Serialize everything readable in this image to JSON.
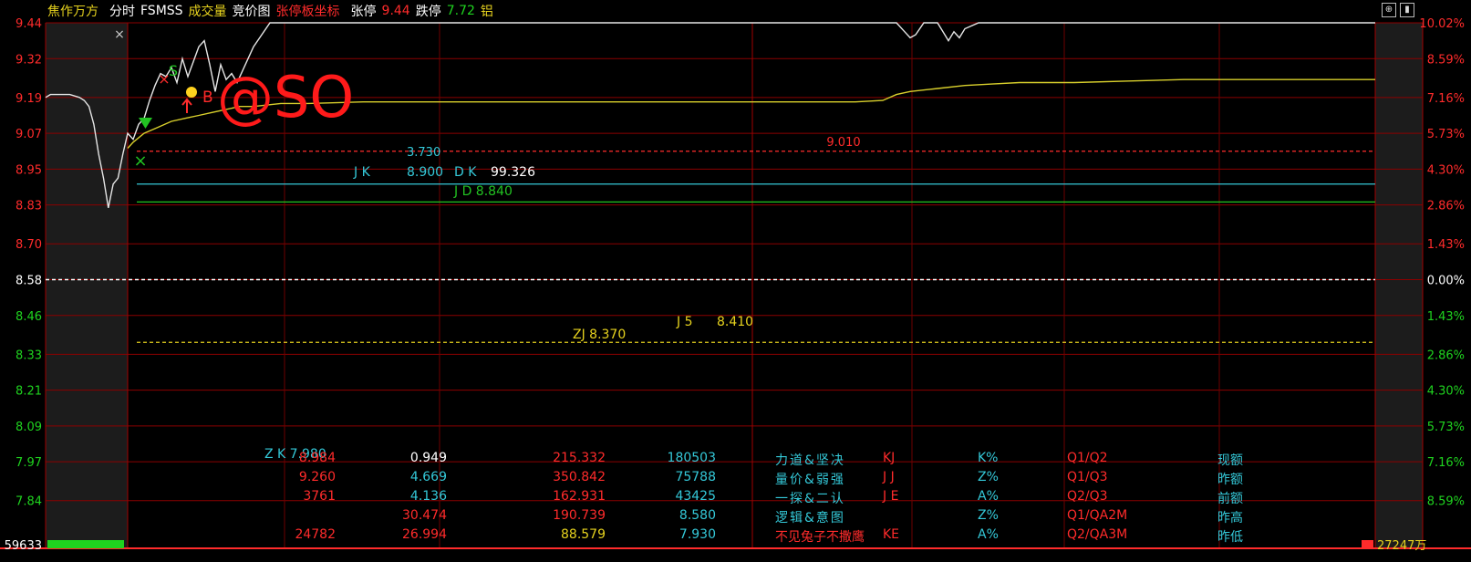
{
  "header": {
    "stock_name": "焦作万方",
    "tab_fenshi": "分时",
    "tab_fsmss": "FSMSS",
    "tab_volume": "成交量",
    "tab_auction": "竞价图",
    "tab_limit_coord": "张停板坐标",
    "limit_up_label": "张停",
    "limit_up_value": "9.44",
    "limit_down_label": "跌停",
    "limit_down_value": "7.72",
    "sector": "铝",
    "close_mark": "×"
  },
  "colors": {
    "price_up": "#ff2b2b",
    "price_down": "#1fd31f",
    "price_line": "#e6e6e6",
    "avg_line": "#d8cf2c",
    "grid": "#8b0000",
    "cyan": "#34c8d8",
    "yellow": "#e6d21e",
    "green": "#22c322"
  },
  "chart_data": {
    "type": "line",
    "title": "",
    "xlabel": "",
    "ylabel": "",
    "prev_close": 8.58,
    "ylim": [
      7.72,
      9.44
    ],
    "y_ticks": [
      "9.44",
      "9.32",
      "9.19",
      "9.07",
      "8.95",
      "8.83",
      "8.70",
      "8.58",
      "8.46",
      "8.33",
      "8.21",
      "8.09",
      "7.97",
      "7.84"
    ],
    "pct_ticks": [
      "10.02%",
      "8.59%",
      "7.16%",
      "5.73%",
      "4.30%",
      "2.86%",
      "1.43%",
      "0.00%",
      "1.43%",
      "2.86%",
      "4.30%",
      "5.73%",
      "7.16%",
      "8.59%"
    ],
    "volume_label": "59633",
    "volume_right_label": "27247万",
    "series": [
      {
        "key": "price",
        "t": [
          0,
          2,
          6,
          10,
          14,
          16,
          18,
          20,
          22,
          24,
          26,
          28,
          30,
          32,
          34,
          36,
          38,
          40,
          42,
          44,
          46,
          48,
          50,
          52,
          54,
          56,
          58,
          60,
          62,
          64,
          66,
          68,
          70,
          72,
          74,
          76,
          78,
          80,
          83,
          86,
          90,
          95,
          100,
          110,
          130,
          200,
          300,
          315,
          318,
          320,
          322,
          325,
          330,
          332,
          334,
          336,
          338,
          340,
          345,
          400,
          490
        ],
        "v": [
          9.19,
          9.2,
          9.2,
          9.2,
          9.19,
          9.18,
          9.16,
          9.1,
          9.0,
          8.92,
          8.82,
          8.9,
          8.92,
          9.0,
          9.07,
          9.05,
          9.1,
          9.12,
          9.18,
          9.23,
          9.27,
          9.26,
          9.29,
          9.24,
          9.32,
          9.26,
          9.31,
          9.36,
          9.38,
          9.3,
          9.21,
          9.3,
          9.25,
          9.27,
          9.24,
          9.28,
          9.32,
          9.36,
          9.4,
          9.44,
          9.44,
          9.44,
          9.44,
          9.44,
          9.44,
          9.44,
          9.44,
          9.44,
          9.41,
          9.39,
          9.4,
          9.44,
          9.44,
          9.41,
          9.38,
          9.41,
          9.39,
          9.42,
          9.44,
          9.44,
          9.44
        ]
      },
      {
        "key": "avg",
        "t": [
          34,
          36,
          40,
          45,
          50,
          55,
          60,
          65,
          70,
          75,
          80,
          90,
          100,
          120,
          150,
          200,
          250,
          300,
          310,
          315,
          320,
          330,
          340,
          350,
          360,
          380,
          400,
          420,
          450,
          490
        ],
        "v": [
          9.02,
          9.04,
          9.07,
          9.09,
          9.11,
          9.12,
          9.13,
          9.14,
          9.15,
          9.16,
          9.16,
          9.17,
          9.17,
          9.175,
          9.175,
          9.175,
          9.175,
          9.175,
          9.18,
          9.2,
          9.21,
          9.22,
          9.23,
          9.235,
          9.24,
          9.24,
          9.245,
          9.25,
          9.25,
          9.25
        ]
      }
    ],
    "reference_lines": [
      {
        "label": "9.010",
        "value": 9.01,
        "style": "dashed",
        "color": "#ff2b2b"
      },
      {
        "label": "",
        "value": 8.9,
        "style": "solid",
        "color": "#34c8d8"
      },
      {
        "label": "",
        "value": 8.84,
        "style": "solid",
        "color": "#22c322"
      },
      {
        "label": "",
        "value": 8.58,
        "style": "dashed",
        "color": "#ffffff"
      },
      {
        "label": "",
        "value": 8.37,
        "style": "dashed",
        "color": "#e6d21e"
      }
    ],
    "annotations": [
      {
        "label": "3.730",
        "color": "#34c8d8"
      },
      {
        "label": "J K",
        "color": "#34c8d8"
      },
      {
        "label": "8.900",
        "color": "#34c8d8"
      },
      {
        "label": "D K",
        "color": "#34c8d8"
      },
      {
        "label": "99.326",
        "color": "#ffffff"
      },
      {
        "label": "J D   8.840",
        "color": "#22c322"
      },
      {
        "label": "ZJ  8.370",
        "color": "#e6d21e"
      },
      {
        "label": "J 5",
        "color": "#e6d21e"
      },
      {
        "label": "8.410",
        "color": "#e6d21e"
      },
      {
        "label": "Z K 7.980",
        "color": "#34c8d8"
      },
      {
        "label": "B",
        "color": "#ff2b2b"
      },
      {
        "label": "@SO",
        "color": "#ff1a1a"
      }
    ]
  },
  "panel": {
    "rows": [
      {
        "title": "力道&坚决",
        "title_color": "#34c8d8",
        "c1": "KJ",
        "c1v": "8.984",
        "c2": "K%",
        "c2v": "0.949",
        "c3": "Q1/Q2",
        "c3v": "215.332",
        "c4": "现额",
        "c4v": "180503",
        "c2v_color": "#ffffff",
        "c3v_color": "#ff2b2b"
      },
      {
        "title": "量价&弱强",
        "title_color": "#34c8d8",
        "c1": "J J",
        "c1v": "9.260",
        "c2": "Z%",
        "c2v": "4.669",
        "c3": "Q1/Q3",
        "c3v": "350.842",
        "c4": "昨额",
        "c4v": "75788",
        "c2v_color": "#34c8d8",
        "c3v_color": "#ff2b2b"
      },
      {
        "title": "一探&二认",
        "title_color": "#34c8d8",
        "c1": "J E",
        "c1v": "3761",
        "c2": "A%",
        "c2v": "4.136",
        "c3": "Q2/Q3",
        "c3v": "162.931",
        "c4": "前额",
        "c4v": "43425",
        "c2v_color": "#34c8d8",
        "c3v_color": "#ff2b2b"
      },
      {
        "title": "逻辑&意图",
        "title_color": "#34c8d8",
        "c1": "",
        "c1v": "",
        "c2": "Z%",
        "c2v": "30.474",
        "c3": "Q1/QA2M",
        "c3v": "190.739",
        "c4": "昨高",
        "c4v": "8.580",
        "c2v_color": "#ff2b2b",
        "c3v_color": "#ff2b2b"
      },
      {
        "title": "不见兔子不撒鹰",
        "title_color": "#ff2b2b",
        "c1": "KE",
        "c1v": "24782",
        "c2": "A%",
        "c2v": "26.994",
        "c3": "Q2/QA3M",
        "c3v": "88.579",
        "c4": "昨低",
        "c4v": "7.930",
        "c2v_color": "#ff2b2b",
        "c3v_color": "#e6d21e"
      }
    ]
  }
}
